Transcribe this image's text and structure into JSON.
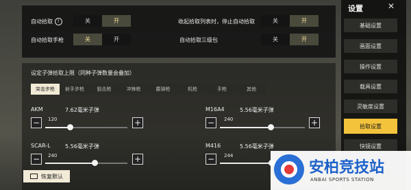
{
  "pickup_options": [
    {
      "label": "自动拾取",
      "off": "关",
      "on": "开",
      "selected": "on",
      "has_help": true
    },
    {
      "label": "收起拾取列表时，停止自动拾取",
      "off": "关",
      "on": "开",
      "selected": "on"
    },
    {
      "label": "自动拾取手枪",
      "off": "关",
      "on": "开",
      "selected": "off"
    },
    {
      "label": "自动拾取三级包",
      "off": "关",
      "on": "开",
      "selected": "on"
    }
  ],
  "help_glyph": "?",
  "ammo_section": {
    "title": "设定子弹拾取上限（同种子弹数量会叠加）"
  },
  "weapon_tabs": [
    "突击步枪",
    "射手步枪",
    "狙击枪",
    "冲锋枪",
    "霰弹枪",
    "机枪",
    "手枪",
    "其他"
  ],
  "active_tab": 0,
  "ammo_limits": [
    {
      "weapon": "AKM",
      "ammo": "7.62毫米子弹",
      "value": "120",
      "fraction": 0.3
    },
    {
      "weapon": "M16A4",
      "ammo": "5.56毫米子弹",
      "value": "240",
      "fraction": 0.6
    },
    {
      "weapon": "SCAR-L",
      "ammo": "5.56毫米子弹",
      "value": "240",
      "fraction": 0.6
    },
    {
      "weapon": "M416",
      "ammo": "5.56毫米子弹",
      "value": "244",
      "fraction": 0.61
    }
  ],
  "minus_glyph": "−",
  "plus_glyph": "+",
  "restore_default": "恢复默认",
  "sidebar": {
    "title": "设置",
    "close_glyph": "✕",
    "items": [
      "基础设置",
      "画面设置",
      "操作设置",
      "载具设置",
      "灵敏度设置",
      "拾取设置",
      "快镜设置"
    ],
    "active": 5
  },
  "watermark": {
    "text_cn": "安柏竞技站",
    "text_en": "ANBAI SPORTS STATION"
  },
  "colors": {
    "accent": "#f3c33b",
    "toggle_on": "#4a4a3c",
    "tab_active": "#f1ead6"
  }
}
